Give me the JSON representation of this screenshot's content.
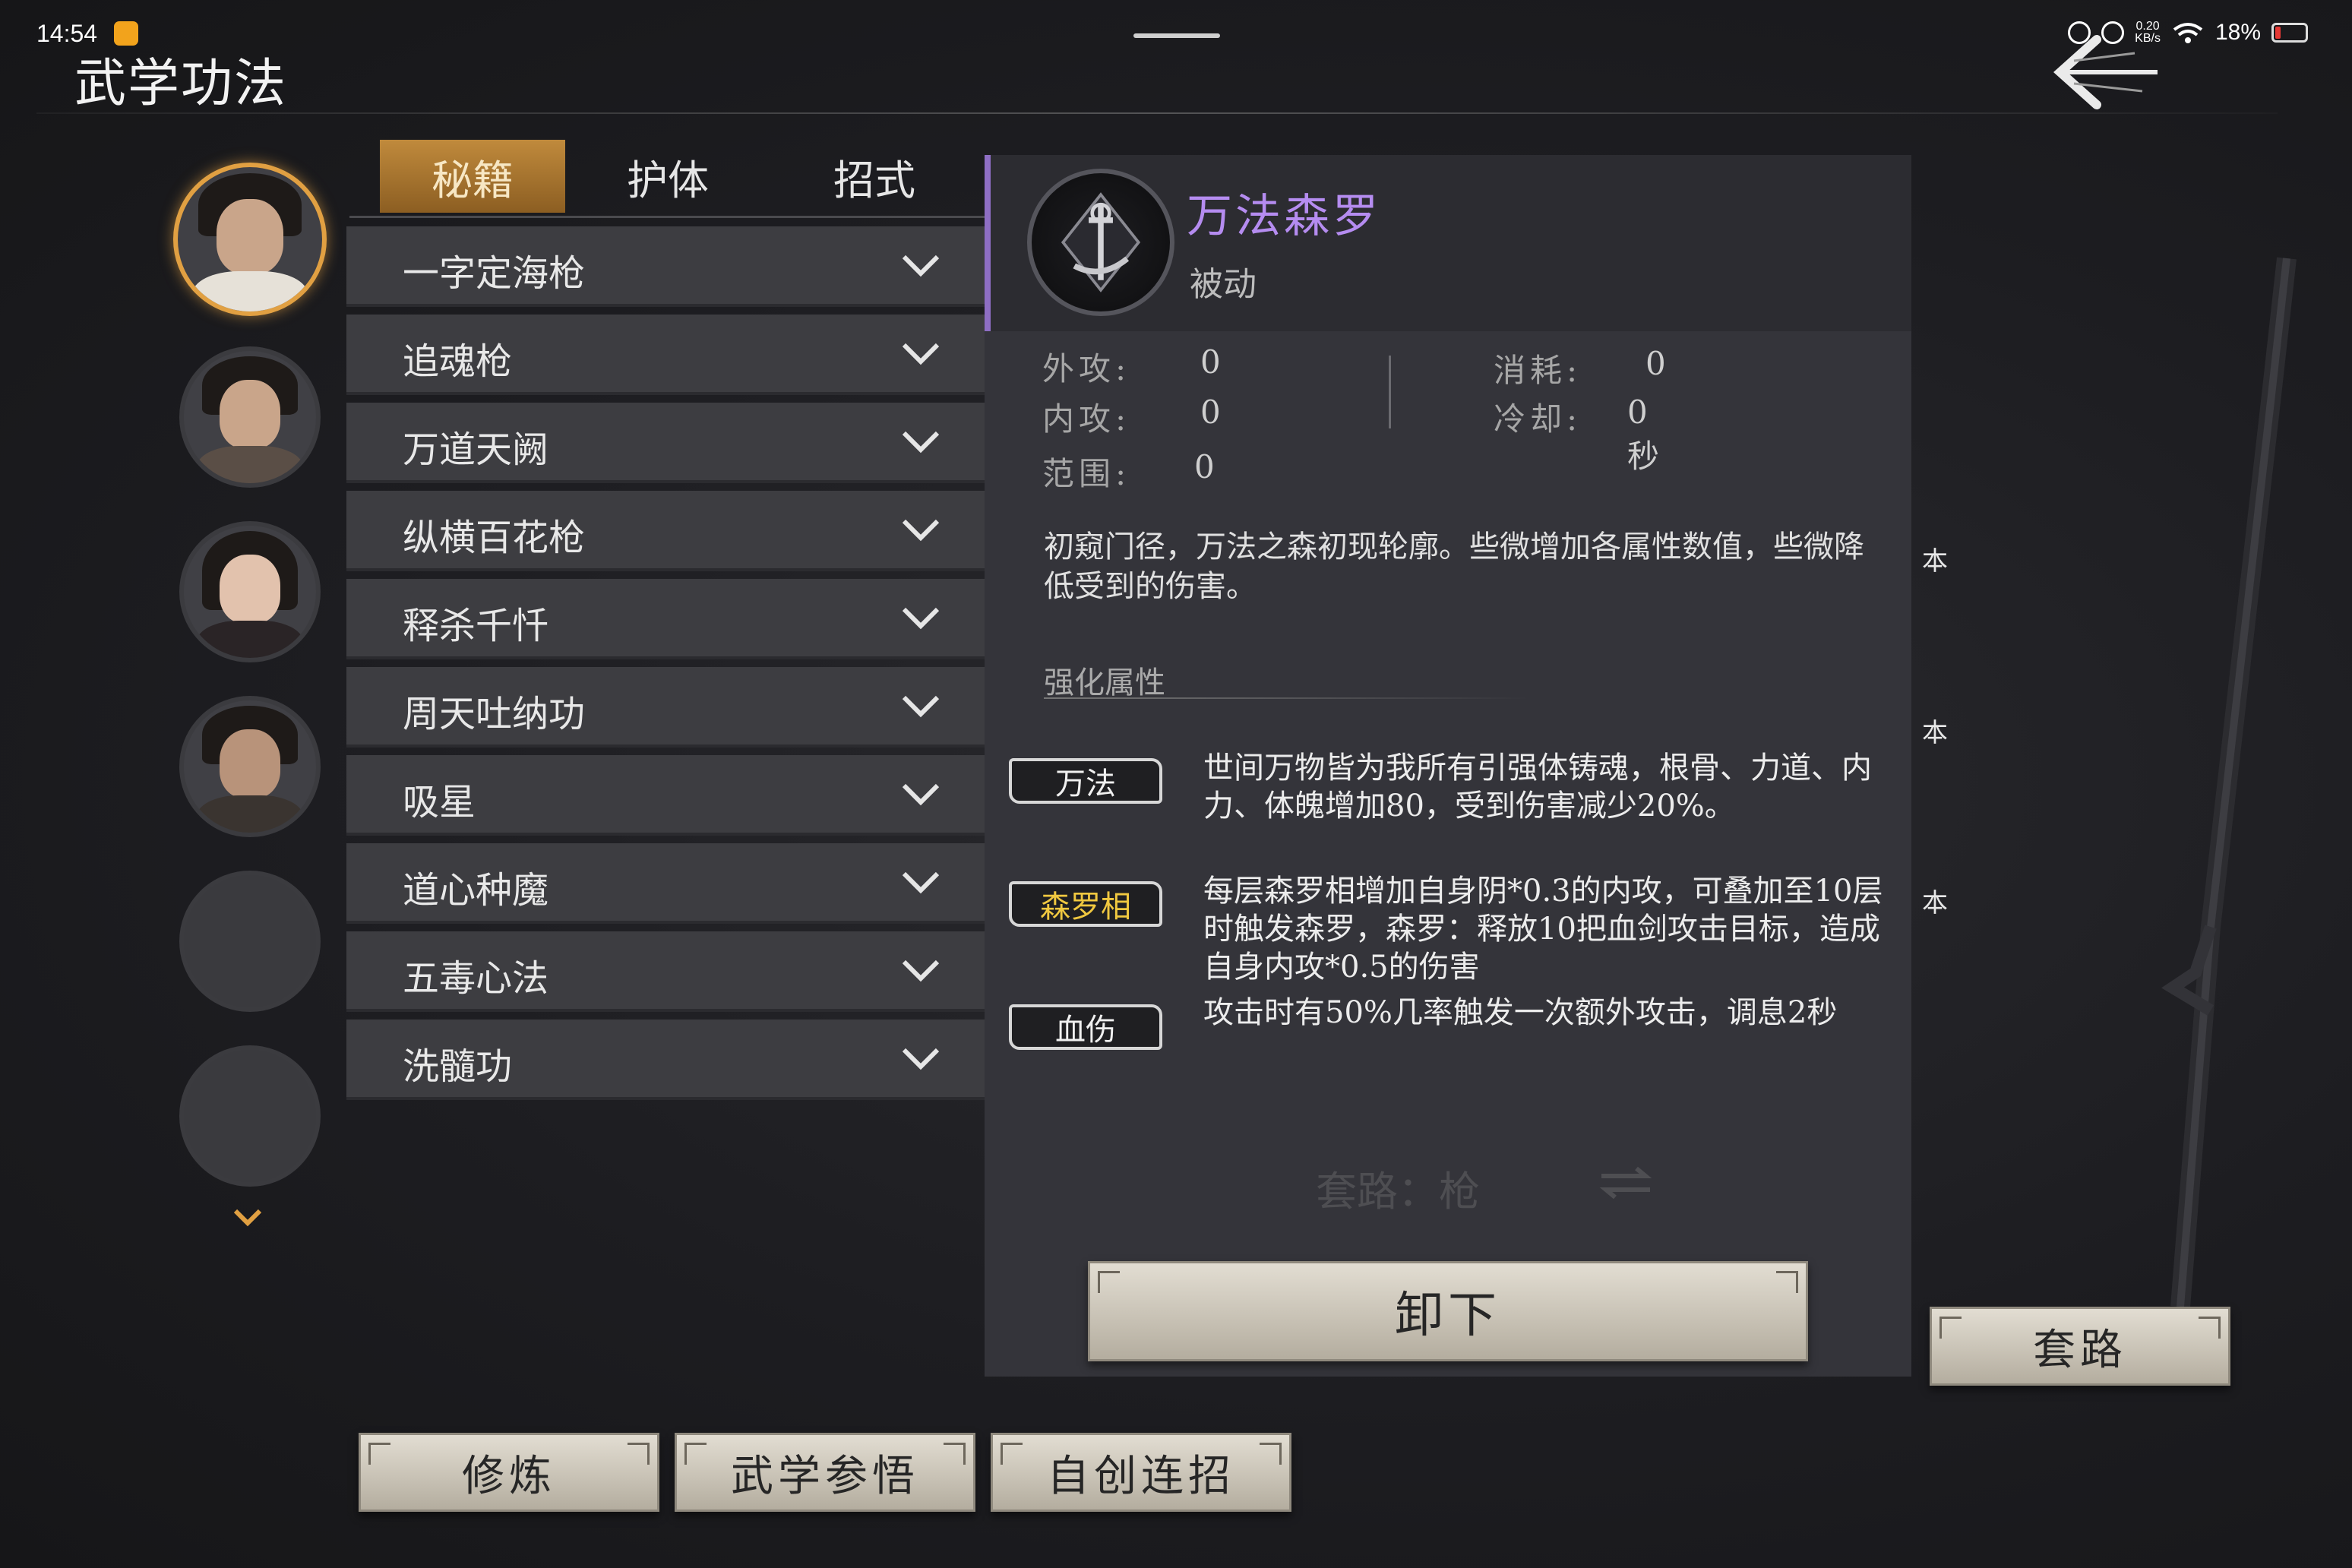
{
  "status_bar": {
    "time": "14:54",
    "net_speed": "0.20\nKB/s",
    "battery": "18%",
    "battery_level": 0.18
  },
  "page_title": "武学功法",
  "tabs": [
    {
      "label": "秘籍",
      "selected": true
    },
    {
      "label": "护体",
      "selected": false
    },
    {
      "label": "招式",
      "selected": false
    }
  ],
  "books": [
    {
      "label": "一字定海枪"
    },
    {
      "label": "追魂枪"
    },
    {
      "label": "万道天阙"
    },
    {
      "label": "纵横百花枪"
    },
    {
      "label": "释杀千忏"
    },
    {
      "label": "周天吐纳功"
    },
    {
      "label": "吸星"
    },
    {
      "label": "道心种魔"
    },
    {
      "label": "五毒心法"
    },
    {
      "label": "洗髓功"
    }
  ],
  "skill": {
    "name": "万法森罗",
    "type": "被动",
    "stats": {
      "outer_attack_label": "外攻:",
      "outer_attack": "0",
      "inner_attack_label": "内攻:",
      "inner_attack": "0",
      "range_label": "范围:",
      "range": "0",
      "cost_label": "消耗:",
      "cost": "0",
      "cooldown_label": "冷却:",
      "cooldown": "0秒"
    },
    "description": "初窥门径，万法之森初现轮廓。些微增加各属性数值，些微降低受到的伤害。",
    "enhance_title": "强化属性",
    "enhancements": [
      {
        "tag": "万法",
        "text": "世间万物皆为我所有引强体铸魂，根骨、力道、内力、体魄增加80，受到伤害减少20%。"
      },
      {
        "tag": "森罗相",
        "text": "每层森罗相增加自身阴*0.3的内攻，可叠加至10层时触发森罗，森罗：释放10把血剑攻击目标，造成自身内攻*0.5的伤害"
      },
      {
        "tag": "血伤",
        "text": "攻击时有50%几率触发一次额外攻击，调息2秒"
      }
    ]
  },
  "taolu_hint": "套路：枪",
  "buttons": {
    "unequip": "卸下",
    "taolu": "套路",
    "practice": "修炼",
    "insight": "武学参悟",
    "combo": "自创连招"
  },
  "side_labels": [
    "本",
    "本",
    "本"
  ],
  "colors": {
    "accent_gold": "#e1a042",
    "skill_name": "#b58cf0",
    "tag_gold": "#f0c840"
  }
}
